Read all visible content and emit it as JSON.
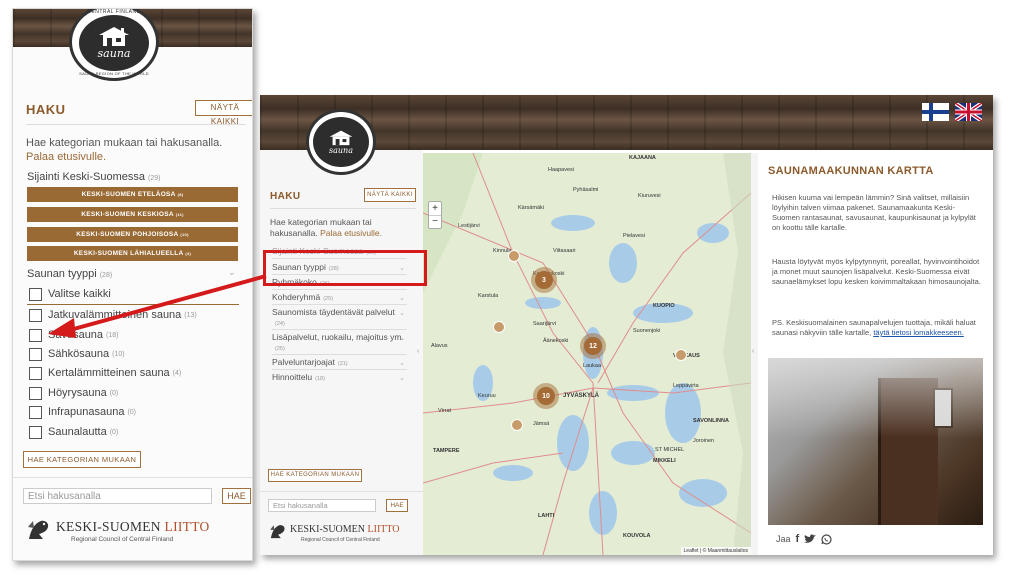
{
  "left_panel": {
    "logo": {
      "top": "CENTRAL FINLAND",
      "main": "sauna",
      "bottom": "SAUNA REGION OF THE WORLD"
    },
    "haku": "HAKU",
    "show_all": "NÄYTÄ KAIKKI",
    "intro": "Hae kategorian mukaan tai hakusanalla.",
    "back_link": "Palaa etusivulle.",
    "location": {
      "label": "Sijainti Keski-Suomessa",
      "count": "(29)",
      "buttons": [
        {
          "label": "KESKI-SUOMEN ETELÄOSA",
          "count": "(8)"
        },
        {
          "label": "KESKI-SUOMEN KESKIOSA",
          "count": "(11)"
        },
        {
          "label": "KESKI-SUOMEN POHJOISOSA",
          "count": "(10)"
        },
        {
          "label": "KESKI-SUOMEN LÄHIALUEELLA",
          "count": "(4)"
        }
      ]
    },
    "sauna_type": {
      "label": "Saunan tyyppi",
      "count": "(28)",
      "items": [
        {
          "label": "Valitse kaikki",
          "count": ""
        },
        {
          "label": "Jatkuvalämmitteinen sauna",
          "count": "(13)"
        },
        {
          "label": "Savusauna",
          "count": "(18)"
        },
        {
          "label": "Sähkösauna",
          "count": "(10)"
        },
        {
          "label": "Kertalämmitteinen sauna",
          "count": "(4)"
        },
        {
          "label": "Höyrysauna",
          "count": "(0)"
        },
        {
          "label": "Infrapunasauna",
          "count": "(0)"
        },
        {
          "label": "Saunalautta",
          "count": "(0)"
        }
      ]
    },
    "search_by_category": "HAE KATEGORIAN MUKAAN",
    "search_placeholder": "Etsi hakusanalla",
    "search_button": "HAE",
    "org_name_a": "KESKI-SUOMEN ",
    "org_name_b": "LIITTO",
    "org_sub": "Regional Council of Central Finland"
  },
  "right_panel": {
    "haku": "HAKU",
    "show_all": "NÄYTÄ KAIKKI",
    "intro": "Hae kategorian mukaan tai hakusanalla.",
    "back_link": "Palaa etusivulle.",
    "categories": [
      {
        "label": "Sijainti Keski-Suomessa",
        "count": "(29)"
      },
      {
        "label": "Saunan tyyppi",
        "count": "(28)"
      },
      {
        "label": "Ryhmäkoko",
        "count": "(26)"
      },
      {
        "label": "Kohderyhmä",
        "count": "(25)"
      },
      {
        "label": "Saunomista täydentävät palvelut",
        "count": "(24)"
      },
      {
        "label": "Lisäpalvelut, ruokailu, majoitus ym.",
        "count": "(25)"
      },
      {
        "label": "Palveluntarjoajat",
        "count": "(21)"
      },
      {
        "label": "Hinnoittelu",
        "count": "(18)"
      }
    ],
    "search_by_category": "HAE KATEGORIAN MUKAAN",
    "search_placeholder": "Etsi hakusanalla",
    "search_button": "HAE",
    "map": {
      "zoom_in": "+",
      "zoom_out": "−",
      "clusters": [
        "3",
        "12",
        "10"
      ],
      "places": [
        "KAJAANA",
        "Haapavesi",
        "Pyhäsalmi",
        "Kiuruvesi",
        "Pielavesi",
        "Kärsämäki",
        "Lestijärvi",
        "Kinnula",
        "Viitasaari",
        "Kannonkoski",
        "Karstula",
        "Saarijärvi",
        "Keuruu",
        "JYVÄSKYLÄ",
        "Äänekoski",
        "Laukaa",
        "Jämsä",
        "MIKKELI",
        "VARKAUS",
        "KUOPIO",
        "SAVONLINNA",
        "ST MICHEL",
        "TAMPERE",
        "LAHTI",
        "KOUVOLA",
        "Alavus",
        "Virrat",
        "Leppävirta",
        "Suonenjoki",
        "Joroinen"
      ],
      "attribution": "Leaflet | © Maanmittauslaitos"
    },
    "info": {
      "title": "SAUNAMAAKUNNAN KARTTA",
      "p1": "Hikisen kuuma vai lempeän lämmin? Sinä valitset, millaisiin löylyihin talven viimaa pakenet. Saunamaakunta Keski-Suomen rantasaunat, savusaunat, kaupunkisaunat ja kylpylät on koottu tälle kartalle.",
      "p2": "Hausta löytyvät myös kylpytynnyrit, poreallat, hyvinvointihoidot ja monet muut saunojen lisäpalvelut. Keski-Suomessa eivät saunaelämykset lopu kesken koivimmaltakaan himosaunojalta.",
      "p3": "PS. Keskisuomalainen saunapalvelujen tuottaja, mikäli haluat saunasi näkyviin tälle kartalle, ",
      "p3_link": "täytä tietosi lomakkeeseen.",
      "share": "Jaa"
    }
  },
  "colors": {
    "brand": "#9a6a35",
    "callout": "#d41a1a"
  }
}
